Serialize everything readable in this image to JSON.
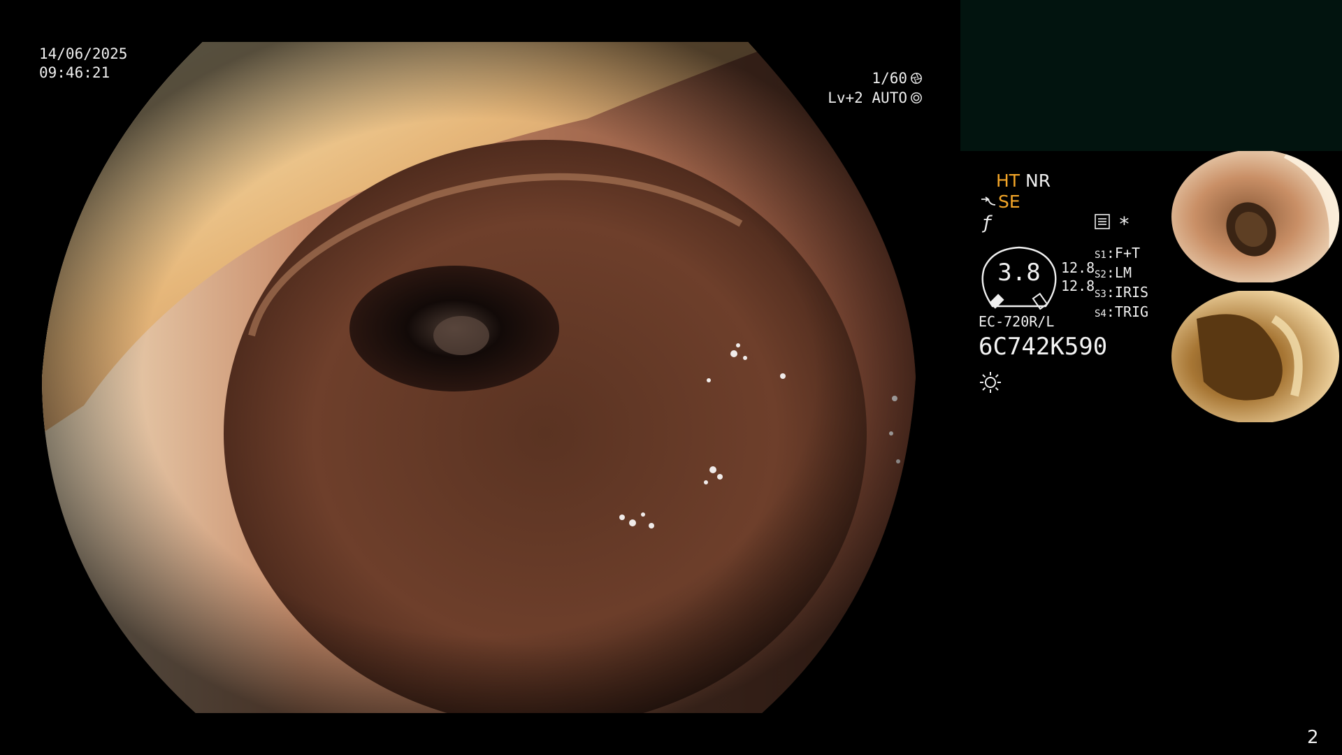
{
  "overlay": {
    "date": "14/06/2025",
    "time": "09:46:21",
    "shutter": "1/60",
    "level_mode": "Lv+2 AUTO"
  },
  "panel": {
    "ht": "HT",
    "nr": "NR",
    "se": "SE",
    "gauge_value": "3.8",
    "value_1": "12.8",
    "value_2": "12.8",
    "switches": [
      {
        "key": "S1",
        "label": "F+T"
      },
      {
        "key": "S2",
        "label": "LM"
      },
      {
        "key": "S3",
        "label": "IRIS"
      },
      {
        "key": "S4",
        "label": "TRIG"
      }
    ],
    "model": "EC-720R/L",
    "serial": "6C742K590"
  },
  "page_number": "2",
  "colors": {
    "accent_orange": "#f4a628",
    "panel_dark": "#02140f"
  }
}
